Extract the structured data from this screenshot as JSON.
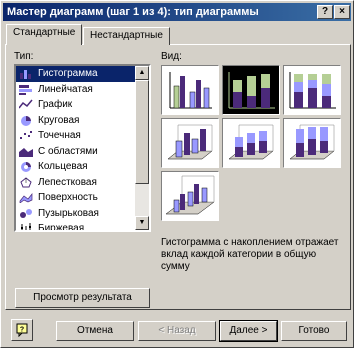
{
  "window": {
    "title": "Мастер диаграмм (шаг 1 из 4): тип диаграммы",
    "help_label": "?",
    "close_label": "×"
  },
  "tabs": [
    {
      "label": "Стандартные",
      "active": true
    },
    {
      "label": "Нестандартные",
      "active": false
    }
  ],
  "type_list": {
    "label": "Тип:",
    "items": [
      {
        "label": "Гистограмма",
        "icon": "histogram-icon",
        "selected": true
      },
      {
        "label": "Линейчатая",
        "icon": "bar-icon"
      },
      {
        "label": "График",
        "icon": "line-icon"
      },
      {
        "label": "Круговая",
        "icon": "pie-icon"
      },
      {
        "label": "Точечная",
        "icon": "scatter-icon"
      },
      {
        "label": "С областями",
        "icon": "area-icon"
      },
      {
        "label": "Кольцевая",
        "icon": "doughnut-icon"
      },
      {
        "label": "Лепестковая",
        "icon": "radar-icon"
      },
      {
        "label": "Поверхность",
        "icon": "surface-icon"
      },
      {
        "label": "Пузырьковая",
        "icon": "bubble-icon"
      },
      {
        "label": "Биржевая",
        "icon": "stock-icon"
      }
    ]
  },
  "subtype": {
    "label": "Вид:",
    "selected_index": 1,
    "description": "Гистограмма с накоплением отражает вклад каждой категории в общую сумму"
  },
  "preview_button": "Просмотр результата",
  "footer": {
    "help_icon": "help-icon",
    "cancel": "Отмена",
    "back": "< Назад",
    "next": "Далее >",
    "finish": "Готово"
  },
  "colors": {
    "title_bar": "#0a246a",
    "selection": "#0a246a",
    "series_purple": "#4b2a7a",
    "series_green": "#b5cf95",
    "series_blue": "#9999ff"
  }
}
